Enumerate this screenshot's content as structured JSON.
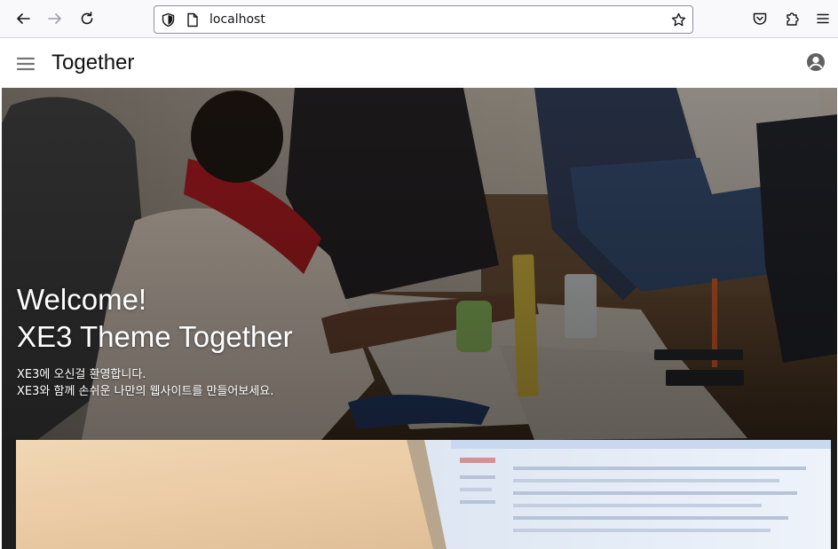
{
  "browser": {
    "url": "localhost",
    "nav_icons": [
      "back-arrow-icon",
      "forward-arrow-icon",
      "reload-icon"
    ],
    "url_icons": [
      "shield-icon",
      "page-icon",
      "star-icon"
    ],
    "right_icons": [
      "pocket-icon",
      "extensions-icon",
      "menu-icon"
    ]
  },
  "site": {
    "title": "Together",
    "menu_icon": "hamburger-icon",
    "account_icon": "user-account-icon"
  },
  "hero": {
    "heading_line1": "Welcome!",
    "heading_line2": "XE3 Theme Together",
    "sub_line1": "XE3에 오신걸 환영합니다.",
    "sub_line2": "XE3와 함께 손쉬운 나만의 웹사이트를 만들어보세요."
  },
  "colors": {
    "toolbar_bg": "#f9f9fb",
    "hero_overlay": "#2b211b",
    "text_white": "#ffffff"
  }
}
